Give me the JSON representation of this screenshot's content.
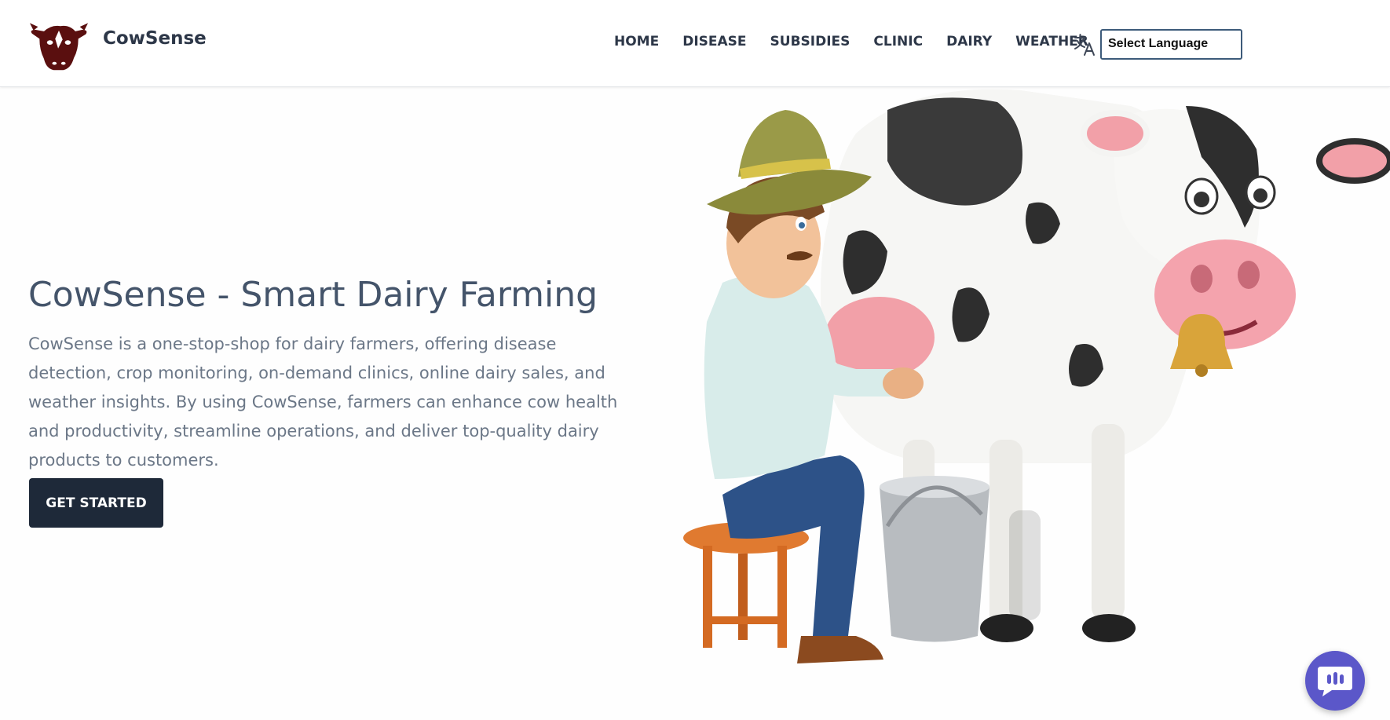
{
  "header": {
    "brand": "CowSense",
    "nav": [
      "HOME",
      "DISEASE",
      "SUBSIDIES",
      "CLINIC",
      "DAIRY",
      "WEATHER"
    ],
    "language_select": "Select Language"
  },
  "hero": {
    "title": "CowSense - Smart Dairy Farming",
    "description": "CowSense is a one-stop-shop for dairy farmers, offering disease detection, crop monitoring, on-demand clinics, online dairy sales, and weather insights. By using CowSense, farmers can enhance cow health and productivity, streamline operations, and deliver top-quality dairy products to customers.",
    "cta": "GET STARTED"
  },
  "icons": {
    "logo": "cow-head-icon",
    "translate": "translate-icon",
    "chat": "chat-bubble-icon"
  },
  "colors": {
    "brand_text": "#2d3748",
    "logo": "#5a0f0f",
    "cta_bg": "#1e2939",
    "chat_fab": "#5b57c9"
  }
}
